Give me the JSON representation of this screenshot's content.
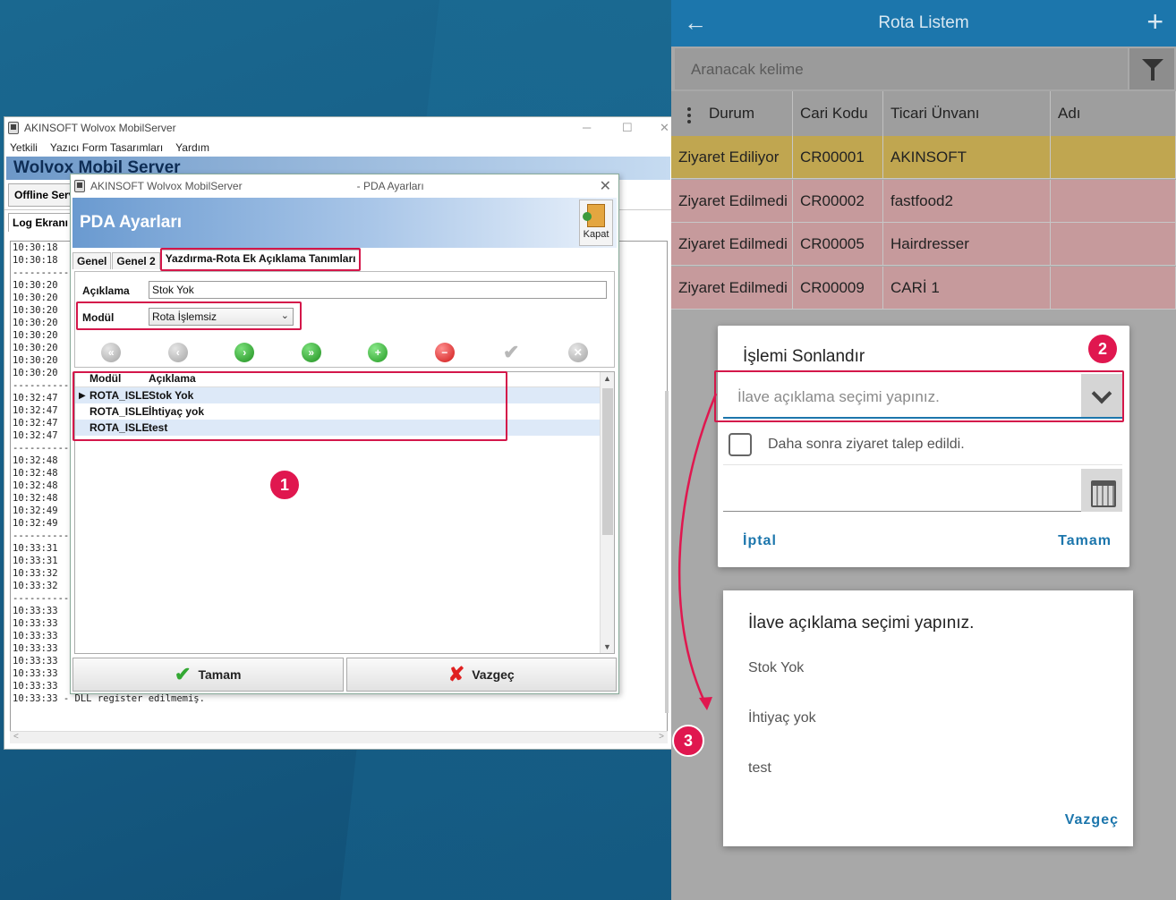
{
  "main_window": {
    "title": "AKINSOFT Wolvox MobilServer",
    "menu": [
      "Yetkili",
      "Yazıcı Form Tasarımları",
      "Yardım"
    ],
    "banner": "Wolvox Mobil Server",
    "toolbar_btn": "Offline Serv",
    "log_tab": "Log Ekranı",
    "log_lines": [
      "10:30:18",
      "10:30:18",
      "-----------",
      "10:30:20",
      "10:30:20",
      "10:30:20",
      "10:30:20",
      "10:30:20",
      "10:30:20",
      "10:30:20",
      "10:30:20",
      "-----------",
      "10:32:47",
      "10:32:47",
      "10:32:47",
      "10:32:47",
      "-----------",
      "10:32:48",
      "10:32:48",
      "10:32:48",
      "10:32:48",
      "10:32:49",
      "10:32:49",
      "-----------",
      "10:33:31",
      "10:33:31",
      "10:33:32",
      "10:33:32",
      "-----------",
      "10:33:33",
      "10:33:33",
      "10:33:33",
      "10:33:33",
      "10:33:33",
      "10:33:33",
      "10:33:33",
      "10:33:33 - DLL register edilmemiş."
    ]
  },
  "pda": {
    "title_left": "AKINSOFT Wolvox MobilServer",
    "title_right": "- PDA Ayarları",
    "header": "PDA Ayarları",
    "kapat": "Kapat",
    "tabs": [
      "Genel",
      "Genel 2",
      "Yazdırma-Rota Ek Açıklama Tanımları"
    ],
    "form": {
      "aciklama_label": "Açıklama",
      "aciklama_value": "Stok Yok",
      "modul_label": "Modül",
      "modul_value": "Rota İşlemsiz"
    },
    "grid": {
      "headers": [
        "Modül",
        "Açıklama"
      ],
      "rows": [
        {
          "modul": "ROTA_ISLEMSIZ",
          "aciklama": "Stok Yok"
        },
        {
          "modul": "ROTA_ISLEMSIZ",
          "aciklama": "İhtiyaç yok"
        },
        {
          "modul": "ROTA_ISLEMSIZ",
          "aciklama": "test"
        }
      ]
    },
    "ok_label": "Tamam",
    "cancel_label": "Vazgeç"
  },
  "badges": [
    "1",
    "2",
    "3"
  ],
  "mobile": {
    "title": "Rota Listem",
    "search_placeholder": "Aranacak kelime",
    "columns": [
      "Durum",
      "Cari Kodu",
      "Ticari Ünvanı",
      "Adı"
    ],
    "rows": [
      {
        "durum": "Ziyaret Ediliyor",
        "cari": "CR00001",
        "unvan": "AKINSOFT",
        "adi": "",
        "color": "#c0a650"
      },
      {
        "durum": "Ziyaret Edilmedi",
        "cari": "CR00002",
        "unvan": "fastfood2",
        "adi": "",
        "color": "#c69a9c"
      },
      {
        "durum": "Ziyaret Edilmedi",
        "cari": "CR00005",
        "unvan": "Hairdresser",
        "adi": "",
        "color": "#c69a9c"
      },
      {
        "durum": "Ziyaret Edilmedi",
        "cari": "CR00009",
        "unvan": "CARİ 1",
        "adi": "",
        "color": "#c69a9c"
      }
    ],
    "dialog": {
      "title": "İşlemi Sonlandır",
      "select_placeholder": "İlave açıklama seçimi yapınız.",
      "checkbox_label": "Daha sonra ziyaret talep edildi.",
      "cancel": "İptal",
      "ok": "Tamam"
    },
    "picker": {
      "title": "İlave açıklama seçimi yapınız.",
      "options": [
        "Stok Yok",
        "İhtiyaç yok",
        "test"
      ],
      "cancel": "Vazgeç"
    }
  },
  "colors": {
    "accent": "#1c76ac",
    "badge": "#e0174f",
    "highlight": "#d4174a"
  }
}
